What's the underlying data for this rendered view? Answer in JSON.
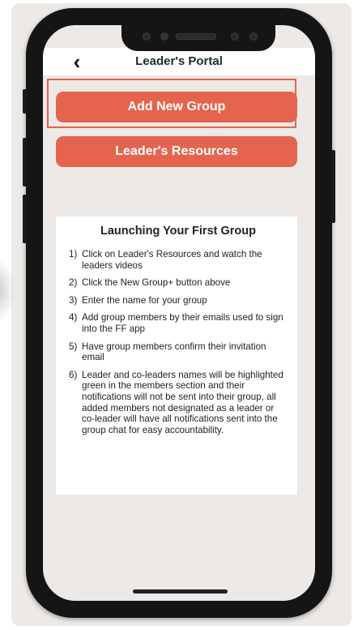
{
  "nav": {
    "title": "Leader's Portal",
    "back_icon": "chevron-left-icon",
    "back_glyph": "‹"
  },
  "buttons": {
    "add_group": "Add New Group",
    "resources": "Leader's Resources"
  },
  "info_card": {
    "title": "Launching Your First Group",
    "steps": [
      {
        "num": "1)",
        "text": "Click on Leader's Resources and watch the leaders videos"
      },
      {
        "num": "2)",
        "text": "Click the New Group+ button above"
      },
      {
        "num": "3)",
        "text": "Enter the name for your group"
      },
      {
        "num": "4)",
        "text": "Add group members by their emails used to sign into the FF app"
      },
      {
        "num": "5)",
        "text": "Have group members confirm their invitation email"
      },
      {
        "num": "6)",
        "text": "Leader and co-leaders names will be highlighted green in the members section and their notifications will not be sent into their group, all added members not designated as a leader or co-leader will have all notifications sent into the group chat for easy accountability."
      }
    ]
  },
  "colors": {
    "accent": "#e5644d",
    "background": "#ece9e6",
    "card": "#ffffff"
  }
}
